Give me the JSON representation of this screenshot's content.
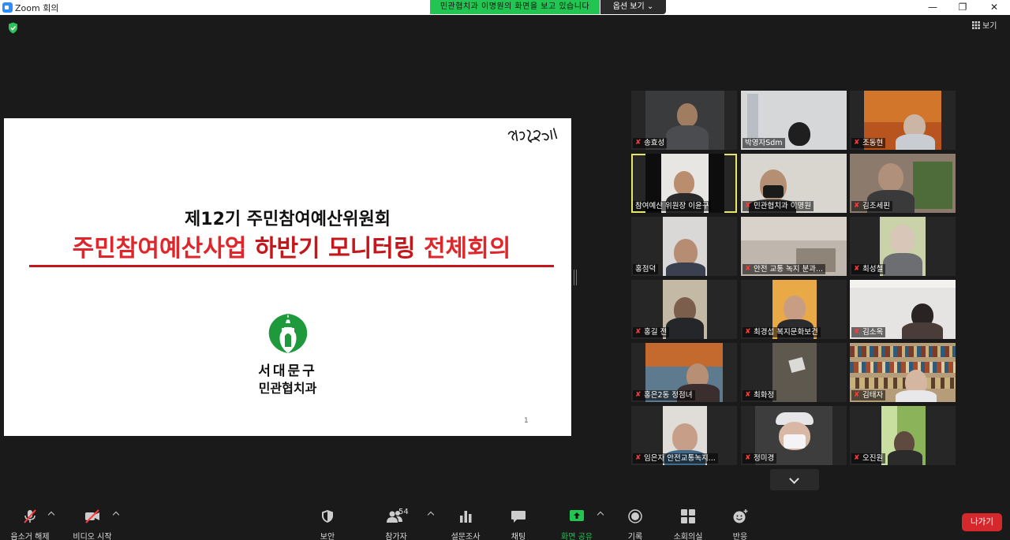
{
  "window": {
    "title": "Zoom 회의",
    "minimize": "—",
    "maximize": "❐",
    "close": "✕"
  },
  "share_banner": {
    "text": "민관협치과 이명원의 화면을 보고 있습니다"
  },
  "view_options": {
    "label": "옵션 보기 ⌄"
  },
  "view_button": {
    "label": "보기"
  },
  "slide": {
    "signature": "행복100% 서대문!",
    "title_line1": "제12기 주민참여예산위원회",
    "title_line2_part1": "주민참여예산사업 ",
    "title_line2_part2": "하반기 모니터링",
    "title_line2_part3": " 전체회의",
    "org_line1": "서대문구",
    "org_line2": "민관협치과",
    "page_number": "1"
  },
  "participants": [
    {
      "name": "송효성",
      "muted": true
    },
    {
      "name": "박영자Sdm",
      "muted": false
    },
    {
      "name": "조동현",
      "muted": true
    },
    {
      "name": "참여예산 위원장 이윤구",
      "muted": false,
      "active": true
    },
    {
      "name": "민관협치과 이명원",
      "muted": true
    },
    {
      "name": "김조세핀",
      "muted": true
    },
    {
      "name": "홍점덕",
      "muted": false
    },
    {
      "name": "안전 교통 녹지 분과...",
      "muted": true
    },
    {
      "name": "최성철",
      "muted": true
    },
    {
      "name": "홍길 전",
      "muted": true
    },
    {
      "name": "최경섭 복지문화보건",
      "muted": true
    },
    {
      "name": "김소옥",
      "muted": true
    },
    {
      "name": "홍은2동 정점녀",
      "muted": true
    },
    {
      "name": "최화정",
      "muted": true
    },
    {
      "name": "김태자",
      "muted": true
    },
    {
      "name": "임은자 안전교통녹지...",
      "muted": true
    },
    {
      "name": "정미경",
      "muted": true
    },
    {
      "name": "오진원",
      "muted": true
    }
  ],
  "toolbar": {
    "mic": "음소거 해제",
    "video": "비디오 시작",
    "security": "보안",
    "participants": "참가자",
    "participants_count": "54",
    "polls": "설문조사",
    "chat": "채팅",
    "share": "화면 공유",
    "record": "기록",
    "breakout": "소회의실",
    "reactions": "반응",
    "leave": "나가기"
  },
  "colors": {
    "share_green": "#23c552",
    "leave_red": "#d4282c",
    "active_border": "#e6e66a",
    "slide_red": "#e0262a"
  }
}
